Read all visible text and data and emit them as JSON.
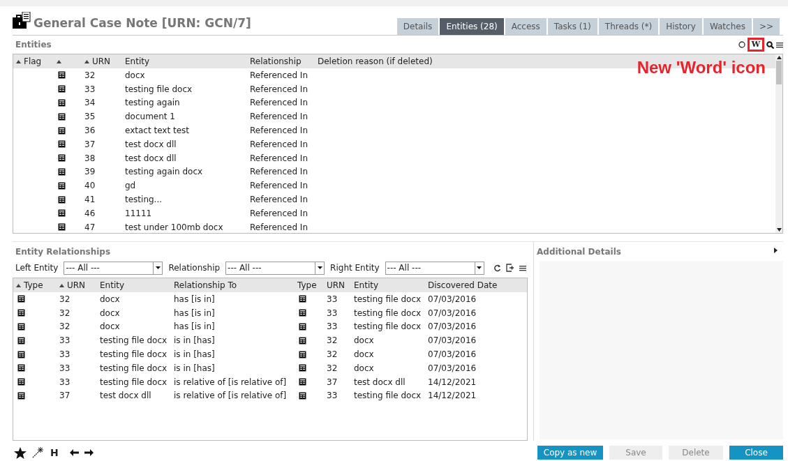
{
  "header": {
    "title": "General Case Note [URN: GCN/7]"
  },
  "tabs": [
    {
      "label": "Details",
      "selected": false
    },
    {
      "label": "Entities (28)",
      "selected": true
    },
    {
      "label": "Access",
      "selected": false
    },
    {
      "label": "Tasks (1)",
      "selected": false
    },
    {
      "label": "Threads (*)",
      "selected": false
    },
    {
      "label": "History",
      "selected": false
    },
    {
      "label": "Watches",
      "selected": false
    },
    {
      "label": ">>",
      "selected": false
    }
  ],
  "entities": {
    "title": "Entities",
    "word_icon": "W",
    "annotation": "New 'Word' icon",
    "columns": [
      {
        "label": "Flag",
        "sort_arrow": true
      },
      {
        "sort_arrow": true
      },
      {
        "label": "URN",
        "sort_arrow": true
      },
      {
        "label": "Entity",
        "sort_arrow": false
      },
      {
        "label": "Relationship",
        "sort_arrow": false
      },
      {
        "label": "Deletion reason (if deleted)",
        "sort_arrow": false
      }
    ],
    "rows": [
      {
        "urn": "32",
        "entity": "docx",
        "relationship": "Referenced In"
      },
      {
        "urn": "33",
        "entity": "testing file docx",
        "relationship": "Referenced In"
      },
      {
        "urn": "34",
        "entity": "testing again",
        "relationship": "Referenced In"
      },
      {
        "urn": "35",
        "entity": "document 1",
        "relationship": "Referenced In"
      },
      {
        "urn": "36",
        "entity": "extact text test",
        "relationship": "Referenced In"
      },
      {
        "urn": "37",
        "entity": "test docx dll",
        "relationship": "Referenced In"
      },
      {
        "urn": "38",
        "entity": "test docx dll",
        "relationship": "Referenced In"
      },
      {
        "urn": "39",
        "entity": "testing again docx",
        "relationship": "Referenced In"
      },
      {
        "urn": "40",
        "entity": "gd",
        "relationship": "Referenced In"
      },
      {
        "urn": "41",
        "entity": "testing...",
        "relationship": "Referenced In"
      },
      {
        "urn": "46",
        "entity": "11111",
        "relationship": "Referenced In"
      },
      {
        "urn": "47",
        "entity": "test under 100mb docx",
        "relationship": "Referenced In"
      }
    ]
  },
  "relationships": {
    "title": "Entity Relationships",
    "filters": [
      {
        "label": "Left Entity",
        "value": "--- All ---"
      },
      {
        "label": "Relationship",
        "value": "--- All ---"
      },
      {
        "label": "Right Entity",
        "value": "--- All ---"
      }
    ],
    "columns": [
      {
        "label": "Type",
        "sort_arrow": true
      },
      {
        "label": "URN",
        "sort_arrow": true
      },
      {
        "label": "Entity",
        "sort_arrow": false
      },
      {
        "label": "Relationship To",
        "sort_arrow": false
      },
      {
        "label": "Type",
        "sort_arrow": false
      },
      {
        "label": "URN",
        "sort_arrow": false
      },
      {
        "label": "Entity",
        "sort_arrow": false
      },
      {
        "label": "Discovered Date",
        "sort_arrow": false
      }
    ],
    "rows": [
      {
        "urn": "32",
        "entity": "docx",
        "relationship_to": "has [is in]",
        "urn_2": "33",
        "entity_2": "testing file docx",
        "discovered_date": "07/03/2016"
      },
      {
        "urn": "32",
        "entity": "docx",
        "relationship_to": "has [is in]",
        "urn_2": "33",
        "entity_2": "testing file docx",
        "discovered_date": "07/03/2016"
      },
      {
        "urn": "32",
        "entity": "docx",
        "relationship_to": "has [is in]",
        "urn_2": "33",
        "entity_2": "testing file docx",
        "discovered_date": "07/03/2016"
      },
      {
        "urn": "33",
        "entity": "testing file docx",
        "relationship_to": "is in [has]",
        "urn_2": "32",
        "entity_2": "docx",
        "discovered_date": "07/03/2016"
      },
      {
        "urn": "33",
        "entity": "testing file docx",
        "relationship_to": "is in [has]",
        "urn_2": "32",
        "entity_2": "docx",
        "discovered_date": "07/03/2016"
      },
      {
        "urn": "33",
        "entity": "testing file docx",
        "relationship_to": "is in [has]",
        "urn_2": "32",
        "entity_2": "docx",
        "discovered_date": "07/03/2016"
      },
      {
        "urn": "33",
        "entity": "testing file docx",
        "relationship_to": "is relative of [is relative of]",
        "urn_2": "37",
        "entity_2": "test docx dll",
        "discovered_date": "14/12/2021"
      },
      {
        "urn": "37",
        "entity": "test docx dll",
        "relationship_to": "is relative of [is relative of]",
        "urn_2": "33",
        "entity_2": "testing file docx",
        "discovered_date": "14/12/2021"
      }
    ]
  },
  "additional_details": {
    "title": "Additional Details"
  },
  "footer": {
    "h_icon": "H"
  },
  "buttons": [
    {
      "label": "Copy as new",
      "disabled": false
    },
    {
      "label": "Save",
      "disabled": true
    },
    {
      "label": "Delete",
      "disabled": true
    },
    {
      "label": "Close",
      "disabled": false
    }
  ]
}
